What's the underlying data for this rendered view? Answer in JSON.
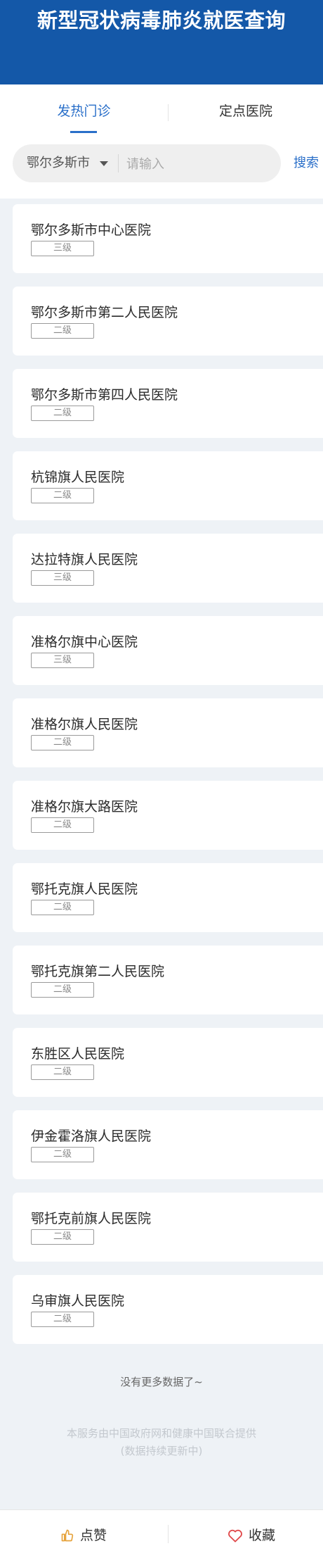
{
  "header": {
    "title": "新型冠状病毒肺炎就医查询"
  },
  "tabs": [
    {
      "label": "发热门诊",
      "active": true
    },
    {
      "label": "定点医院",
      "active": false
    }
  ],
  "search": {
    "city": "鄂尔多斯市",
    "placeholder": "请输入",
    "value": "",
    "button_label": "搜索"
  },
  "hospitals": [
    {
      "name": "鄂尔多斯市中心医院",
      "level": "三级"
    },
    {
      "name": "鄂尔多斯市第二人民医院",
      "level": "二级"
    },
    {
      "name": "鄂尔多斯市第四人民医院",
      "level": "二级"
    },
    {
      "name": "杭锦旗人民医院",
      "level": "二级"
    },
    {
      "name": "达拉特旗人民医院",
      "level": "三级"
    },
    {
      "name": "准格尔旗中心医院",
      "level": "三级"
    },
    {
      "name": "准格尔旗人民医院",
      "level": "二级"
    },
    {
      "name": "准格尔旗大路医院",
      "level": "二级"
    },
    {
      "name": "鄂托克旗人民医院",
      "level": "二级"
    },
    {
      "name": "鄂托克旗第二人民医院",
      "level": "二级"
    },
    {
      "name": "东胜区人民医院",
      "level": "二级"
    },
    {
      "name": "伊金霍洛旗人民医院",
      "level": "二级"
    },
    {
      "name": "鄂托克前旗人民医院",
      "level": "二级"
    },
    {
      "name": "乌审旗人民医院",
      "level": "二级"
    }
  ],
  "list_end_text": "没有更多数据了~",
  "footer": {
    "line1": "本服务由中国政府网和健康中国联合提供",
    "line2": "(数据持续更新中)"
  },
  "bottom_bar": {
    "like_label": "点赞",
    "like_icon": "thumbs-up-icon",
    "favorite_label": "收藏",
    "favorite_icon": "heart-icon"
  },
  "colors": {
    "header_bg": "#1458a8",
    "accent": "#2a6fc9",
    "favorite_accent": "#e0484a",
    "like_accent": "#e6a33c"
  }
}
